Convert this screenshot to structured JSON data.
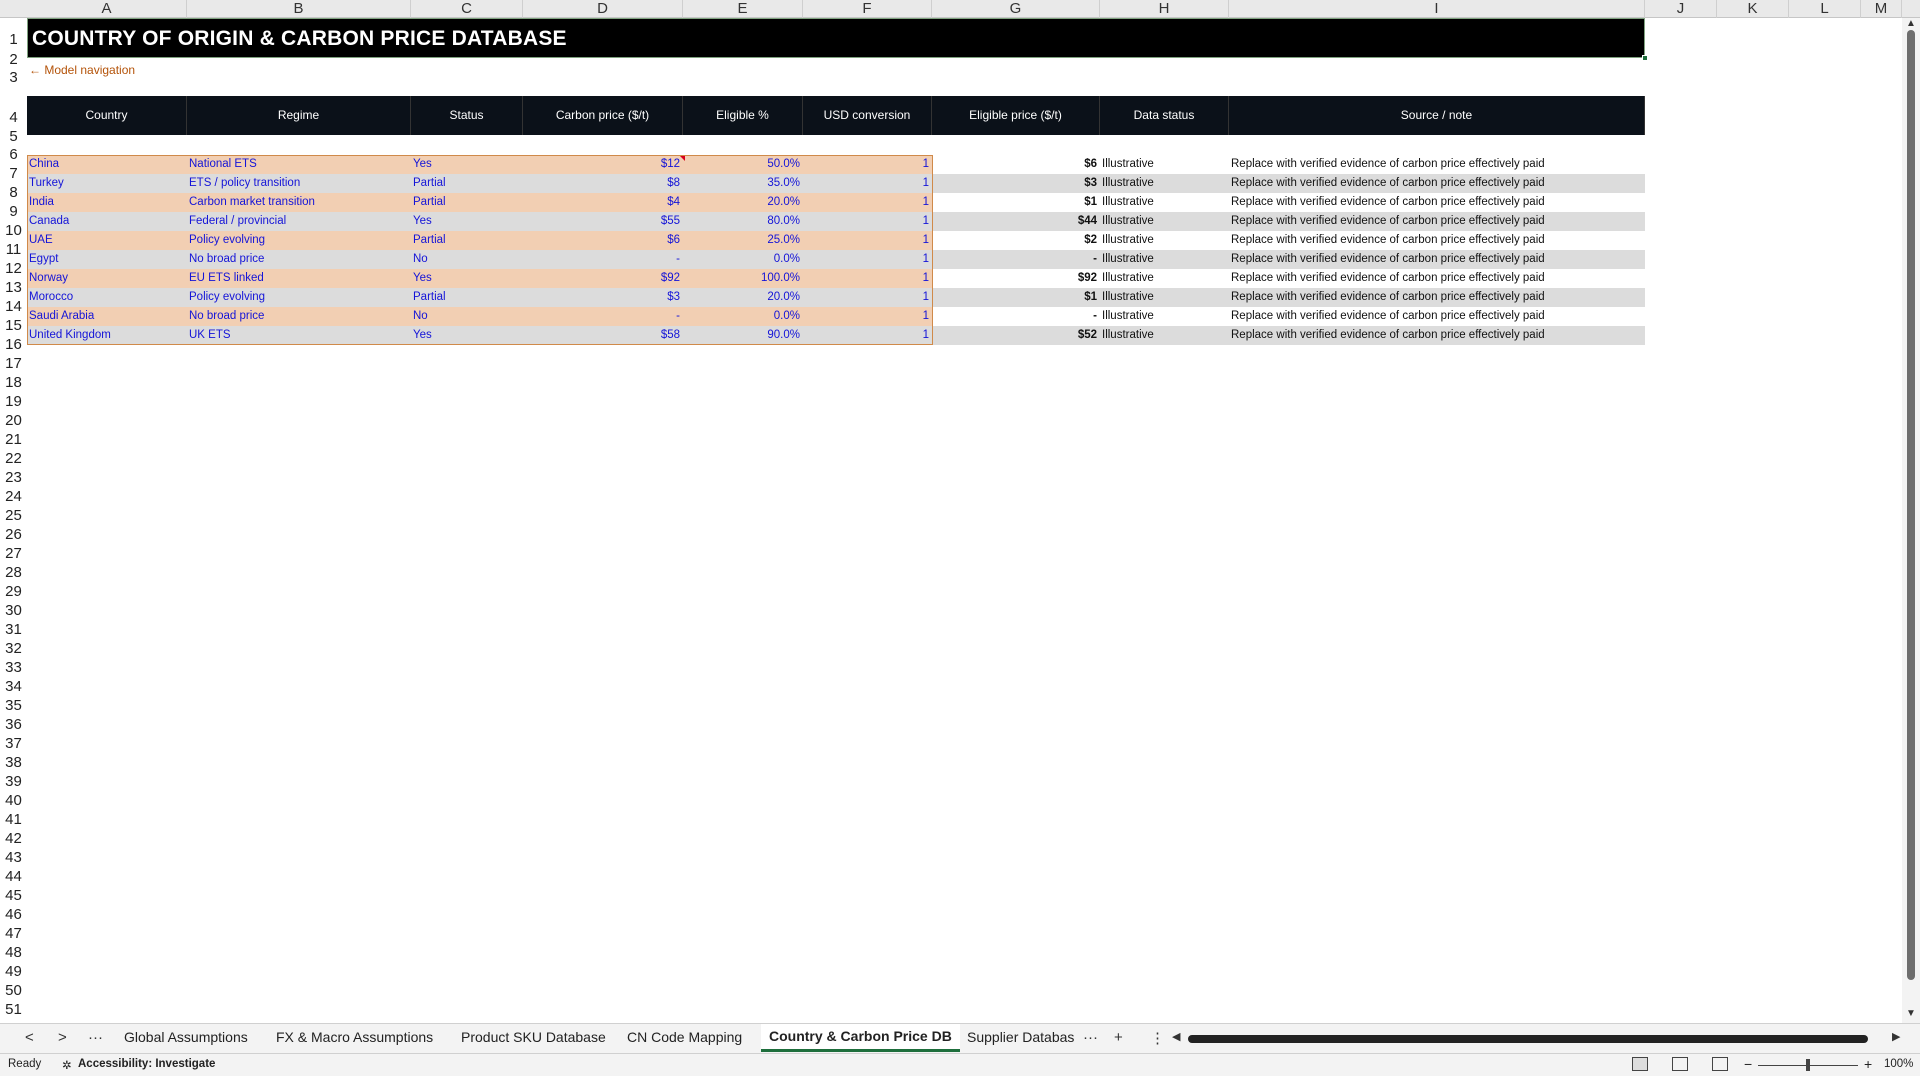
{
  "columns": [
    "A",
    "B",
    "C",
    "D",
    "E",
    "F",
    "G",
    "H",
    "I",
    "J",
    "K",
    "L",
    "M"
  ],
  "rows": [
    "1",
    "2",
    "3",
    "4",
    "5",
    "6",
    "7",
    "8",
    "9",
    "10",
    "11",
    "12",
    "13",
    "14",
    "15",
    "16",
    "17",
    "18",
    "19",
    "20",
    "21",
    "22",
    "23",
    "24",
    "25",
    "26",
    "27",
    "28",
    "29",
    "30",
    "31",
    "32",
    "33",
    "34",
    "35",
    "36",
    "37",
    "38",
    "39",
    "40",
    "41",
    "42",
    "43",
    "44",
    "45",
    "46",
    "47",
    "48",
    "49",
    "50",
    "51"
  ],
  "title": "COUNTRY OF ORIGIN & CARBON PRICE DATABASE",
  "nav_link": "← Model navigation",
  "headers": [
    "Country",
    "Regime",
    "Status",
    "Carbon price ($/t)",
    "Eligible %",
    "USD conversion",
    "Eligible price ($/t)",
    "Data status",
    "Source / note"
  ],
  "table": [
    {
      "country": "China",
      "regime": "National ETS",
      "status": "Yes",
      "price": "$12",
      "eligible": "50.0%",
      "usd": "1",
      "eprice": "$6",
      "dstatus": "Illustrative",
      "note": "Replace with verified evidence of carbon price effectively paid"
    },
    {
      "country": "Turkey",
      "regime": "ETS / policy transition",
      "status": "Partial",
      "price": "$8",
      "eligible": "35.0%",
      "usd": "1",
      "eprice": "$3",
      "dstatus": "Illustrative",
      "note": "Replace with verified evidence of carbon price effectively paid"
    },
    {
      "country": "India",
      "regime": "Carbon market transition",
      "status": "Partial",
      "price": "$4",
      "eligible": "20.0%",
      "usd": "1",
      "eprice": "$1",
      "dstatus": "Illustrative",
      "note": "Replace with verified evidence of carbon price effectively paid"
    },
    {
      "country": "Canada",
      "regime": "Federal / provincial",
      "status": "Yes",
      "price": "$55",
      "eligible": "80.0%",
      "usd": "1",
      "eprice": "$44",
      "dstatus": "Illustrative",
      "note": "Replace with verified evidence of carbon price effectively paid"
    },
    {
      "country": "UAE",
      "regime": "Policy evolving",
      "status": "Partial",
      "price": "$6",
      "eligible": "25.0%",
      "usd": "1",
      "eprice": "$2",
      "dstatus": "Illustrative",
      "note": "Replace with verified evidence of carbon price effectively paid"
    },
    {
      "country": "Egypt",
      "regime": "No broad price",
      "status": "No",
      "price": "-",
      "eligible": "0.0%",
      "usd": "1",
      "eprice": "-",
      "dstatus": "Illustrative",
      "note": "Replace with verified evidence of carbon price effectively paid"
    },
    {
      "country": "Norway",
      "regime": "EU ETS linked",
      "status": "Yes",
      "price": "$92",
      "eligible": "100.0%",
      "usd": "1",
      "eprice": "$92",
      "dstatus": "Illustrative",
      "note": "Replace with verified evidence of carbon price effectively paid"
    },
    {
      "country": "Morocco",
      "regime": "Policy evolving",
      "status": "Partial",
      "price": "$3",
      "eligible": "20.0%",
      "usd": "1",
      "eprice": "$1",
      "dstatus": "Illustrative",
      "note": "Replace with verified evidence of carbon price effectively paid"
    },
    {
      "country": "Saudi Arabia",
      "regime": "No broad price",
      "status": "No",
      "price": "-",
      "eligible": "0.0%",
      "usd": "1",
      "eprice": "-",
      "dstatus": "Illustrative",
      "note": "Replace with verified evidence of carbon price effectively paid"
    },
    {
      "country": "United Kingdom",
      "regime": "UK ETS",
      "status": "Yes",
      "price": "$58",
      "eligible": "90.0%",
      "usd": "1",
      "eprice": "$52",
      "dstatus": "Illustrative",
      "note": "Replace with verified evidence of carbon price effectively paid"
    }
  ],
  "tabs": [
    "Global Assumptions",
    "FX & Macro Assumptions",
    "Product SKU Database",
    "CN Code Mapping",
    "Country & Carbon Price DB",
    "Supplier Databas"
  ],
  "active_tab": "Country & Carbon Price DB",
  "tab_nav": {
    "prev": "<",
    "next": ">",
    "more": "···",
    "more_right": "···",
    "add": "+",
    "options": "⋮"
  },
  "status": {
    "ready": "Ready",
    "accessibility": "Accessibility: Investigate",
    "zoom": "100%",
    "zoom_minus": "−",
    "zoom_plus": "+"
  },
  "colors": {
    "input_orange": "#f2cfb3",
    "input_gray": "#dcdcdc",
    "input_text": "#1414d8",
    "header_bg": "#0b1119",
    "accent": "#1e6e3c"
  }
}
